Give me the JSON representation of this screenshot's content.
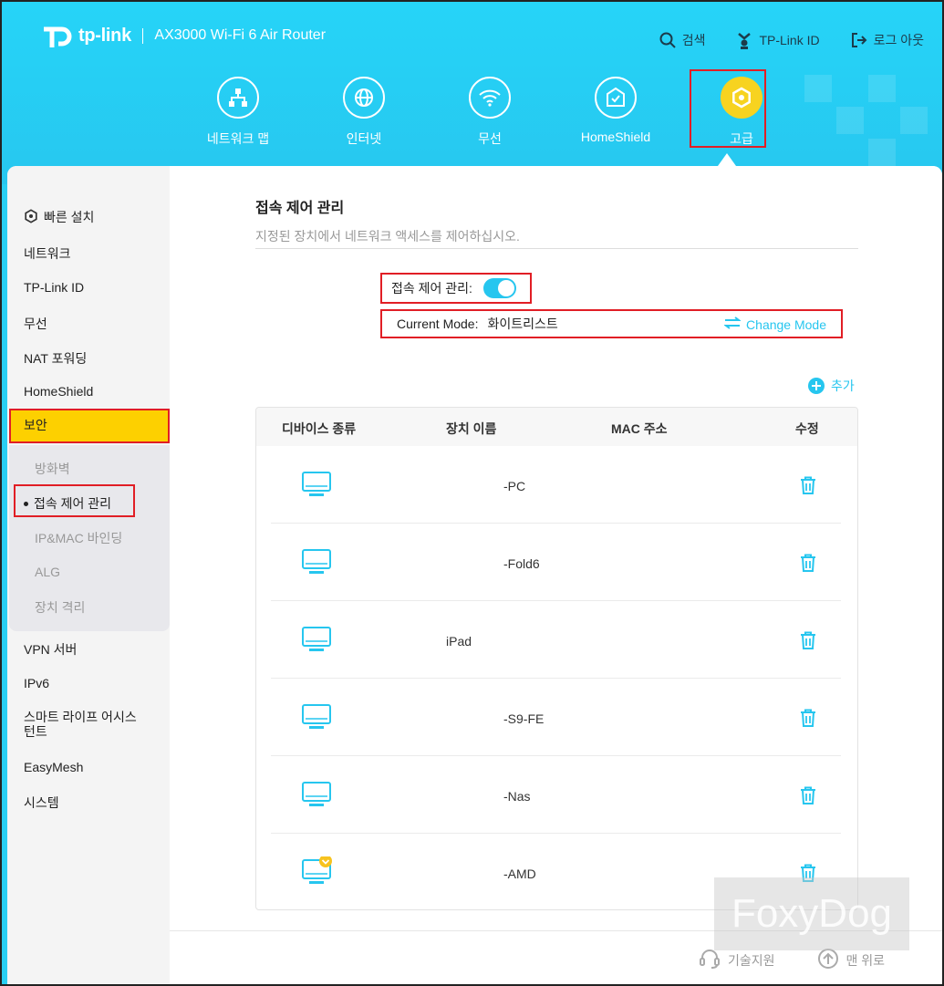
{
  "brand": {
    "logo_text": "tp-link",
    "model": "AX3000 Wi-Fi 6 Air Router"
  },
  "topnav": {
    "search": "검색",
    "tplink_id": "TP-Link ID",
    "logout": "로그 아웃"
  },
  "mainnav": [
    {
      "label": "네트워크 맵",
      "icon": "network-map-icon"
    },
    {
      "label": "인터넷",
      "icon": "globe-icon"
    },
    {
      "label": "무선",
      "icon": "wifi-icon"
    },
    {
      "label": "HomeShield",
      "icon": "homeshield-icon"
    },
    {
      "label": "고급",
      "icon": "advanced-gear-icon",
      "active": true
    }
  ],
  "sidebar": {
    "items": [
      {
        "label": "빠른 설치"
      },
      {
        "label": "네트워크"
      },
      {
        "label": "TP-Link ID"
      },
      {
        "label": "무선"
      },
      {
        "label": "NAT 포워딩"
      },
      {
        "label": "HomeShield"
      },
      {
        "label": "보안"
      },
      {
        "label": "VPN 서버"
      },
      {
        "label": "IPv6"
      },
      {
        "label": "스마트 라이프 어시스턴트"
      },
      {
        "label": "EasyMesh"
      },
      {
        "label": "시스템"
      }
    ],
    "security_sub": [
      {
        "label": "방화벽"
      },
      {
        "label": "접속 제어 관리"
      },
      {
        "label": "IP&MAC 바인딩"
      },
      {
        "label": "ALG"
      },
      {
        "label": "장치 격리"
      }
    ]
  },
  "page": {
    "title": "접속 제어 관리",
    "subtitle": "지정된 장치에서 네트워크 액세스를 제어하십시오.",
    "toggle_label": "접속 제어 관리:",
    "toggle_on": true,
    "current_mode_label": "Current Mode:",
    "current_mode_value": "화이트리스트",
    "change_mode": "Change Mode",
    "add": "추가"
  },
  "table": {
    "headers": {
      "type": "디바이스 종류",
      "name": "장치 이름",
      "mac": "MAC 주소",
      "edit": "수정"
    },
    "rows": [
      {
        "name": "-PC"
      },
      {
        "name": "-Fold6"
      },
      {
        "name": "iPad"
      },
      {
        "name": "-S9-FE"
      },
      {
        "name": "-Nas"
      },
      {
        "name": "-AMD",
        "badge": true
      }
    ]
  },
  "footer": {
    "support": "기술지원",
    "top": "맨 위로"
  },
  "watermark": "FoxyDog",
  "colors": {
    "accent": "#26c6ef",
    "header": "#27cff4",
    "active_yellow": "#fdd000",
    "highlight_red": "#e11e25"
  }
}
